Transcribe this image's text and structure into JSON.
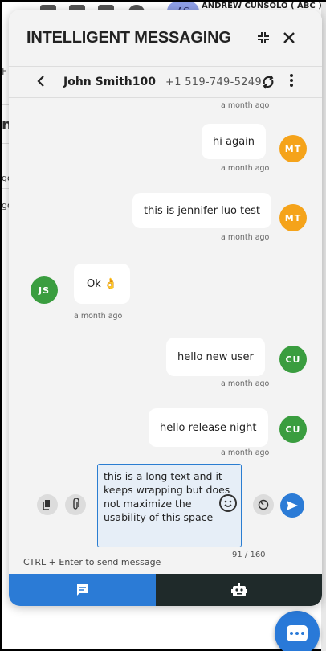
{
  "background": {
    "user_name": "ANDREW CUNSOLO ( ABC )",
    "user_initials": "AC",
    "side_texts": [
      "F",
      "ny",
      "go s",
      "go s"
    ]
  },
  "panel": {
    "title": "INTELLIGENT MESSAGING"
  },
  "contact": {
    "name": "John Smith100",
    "phone": "+1 519-749-5249"
  },
  "messages": [
    {
      "timestamp": "a month ago"
    },
    {
      "text": "hi again",
      "initials": "MT",
      "timestamp": "a month ago",
      "side": "right"
    },
    {
      "text": "this is jennifer luo test",
      "initials": "MT",
      "timestamp": "a month ago",
      "side": "right"
    },
    {
      "text": "Ok 👌",
      "initials": "JS",
      "timestamp": "a month ago",
      "side": "left"
    },
    {
      "text": "hello new user",
      "initials": "CU",
      "timestamp": "a month ago",
      "side": "right"
    },
    {
      "text": "hello release night",
      "initials": "CU",
      "timestamp": "a month ago",
      "side": "right"
    }
  ],
  "composer": {
    "value": "this is a long text and it keeps wrapping but does not maximize the usability of this space",
    "counter": "91 / 160",
    "hint": "CTRL + Enter to send message"
  },
  "colors": {
    "accent": "#2b7bd6",
    "mt_avatar": "#f5a31a",
    "js_avatar": "#3a9d3f",
    "cu_avatar": "#3a9d3f",
    "bot_tab": "#1f2a2a"
  },
  "icons": {
    "header": [
      "collapse-icon",
      "close-icon"
    ],
    "contact_bar": [
      "back-icon",
      "sync-icon",
      "more-vert-icon"
    ],
    "composer": [
      "document-icon",
      "attach-icon",
      "emoji-icon",
      "timer-icon",
      "send-icon"
    ],
    "tabs": [
      "message-icon",
      "robot-icon"
    ]
  }
}
